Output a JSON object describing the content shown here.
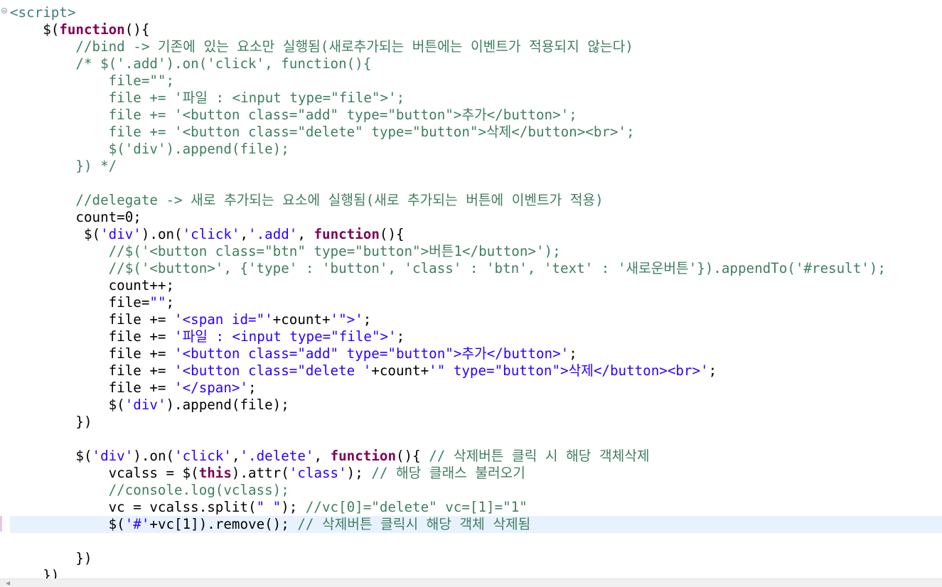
{
  "editor": {
    "lines": [
      [
        {
          "t": "<script>",
          "c": "tag"
        }
      ],
      [
        {
          "t": "    $(",
          "c": ""
        },
        {
          "t": "function",
          "c": "kw"
        },
        {
          "t": "(){",
          "c": ""
        }
      ],
      [
        {
          "t": "        //bind -> 기존에 있는 요소만 실행됨(새로추가되는 버튼에는 이벤트가 적용되지 않는다)",
          "c": "cm"
        }
      ],
      [
        {
          "t": "        /* $('.add').on('click', function(){",
          "c": "cm"
        }
      ],
      [
        {
          "t": "            file=\"\";",
          "c": "cm"
        }
      ],
      [
        {
          "t": "            file += '파일 : <input type=\"file\">';",
          "c": "cm"
        }
      ],
      [
        {
          "t": "            file += '<button class=\"add\" type=\"button\">추가</button>';",
          "c": "cm"
        }
      ],
      [
        {
          "t": "            file += '<button class=\"delete\" type=\"button\">삭제</button><br>';",
          "c": "cm"
        }
      ],
      [
        {
          "t": "            $('div').append(file);",
          "c": "cm"
        }
      ],
      [
        {
          "t": "        }) */",
          "c": "cm"
        }
      ],
      [
        {
          "t": "",
          "c": ""
        }
      ],
      [
        {
          "t": "        //delegate -> 새로 추가되는 요소에 실행됨(새로 추가되는 버튼에 이벤트가 적용)",
          "c": "cm"
        }
      ],
      [
        {
          "t": "        count=0;",
          "c": ""
        }
      ],
      [
        {
          "t": "         $(",
          "c": ""
        },
        {
          "t": "'div'",
          "c": "str"
        },
        {
          "t": ").on(",
          "c": ""
        },
        {
          "t": "'click'",
          "c": "str"
        },
        {
          "t": ",",
          "c": ""
        },
        {
          "t": "'.add'",
          "c": "str"
        },
        {
          "t": ", ",
          "c": ""
        },
        {
          "t": "function",
          "c": "kw"
        },
        {
          "t": "(){",
          "c": ""
        }
      ],
      [
        {
          "t": "            //$('<button class=\"btn\" type=\"button\">버튼1</button>');",
          "c": "cm"
        }
      ],
      [
        {
          "t": "            //$('<button>', {'type' : 'button', 'class' : 'btn', 'text' : '새로운버튼'}).appendTo('#result');",
          "c": "cm"
        }
      ],
      [
        {
          "t": "            count++;",
          "c": ""
        }
      ],
      [
        {
          "t": "            file=",
          "c": ""
        },
        {
          "t": "\"\"",
          "c": "str"
        },
        {
          "t": ";",
          "c": ""
        }
      ],
      [
        {
          "t": "            file += ",
          "c": ""
        },
        {
          "t": "'<span id=\"'",
          "c": "str"
        },
        {
          "t": "+count+",
          "c": ""
        },
        {
          "t": "'\">'",
          "c": "str"
        },
        {
          "t": ";",
          "c": ""
        }
      ],
      [
        {
          "t": "            file += ",
          "c": ""
        },
        {
          "t": "'파일 : <input type=\"file\">'",
          "c": "str"
        },
        {
          "t": ";",
          "c": ""
        }
      ],
      [
        {
          "t": "            file += ",
          "c": ""
        },
        {
          "t": "'<button class=\"add\" type=\"button\">추가</button>'",
          "c": "str"
        },
        {
          "t": ";",
          "c": ""
        }
      ],
      [
        {
          "t": "            file += ",
          "c": ""
        },
        {
          "t": "'<button class=\"delete '",
          "c": "str"
        },
        {
          "t": "+count+",
          "c": ""
        },
        {
          "t": "'\" type=\"button\">삭제</button><br>'",
          "c": "str"
        },
        {
          "t": ";",
          "c": ""
        }
      ],
      [
        {
          "t": "            file += ",
          "c": ""
        },
        {
          "t": "'</span>'",
          "c": "str"
        },
        {
          "t": ";",
          "c": ""
        }
      ],
      [
        {
          "t": "            $(",
          "c": ""
        },
        {
          "t": "'div'",
          "c": "str"
        },
        {
          "t": ").append(file);",
          "c": ""
        }
      ],
      [
        {
          "t": "        })",
          "c": ""
        }
      ],
      [
        {
          "t": "",
          "c": ""
        }
      ],
      [
        {
          "t": "        $(",
          "c": ""
        },
        {
          "t": "'div'",
          "c": "str"
        },
        {
          "t": ").on(",
          "c": ""
        },
        {
          "t": "'click'",
          "c": "str"
        },
        {
          "t": ",",
          "c": ""
        },
        {
          "t": "'.delete'",
          "c": "str"
        },
        {
          "t": ", ",
          "c": ""
        },
        {
          "t": "function",
          "c": "kw"
        },
        {
          "t": "(){ ",
          "c": ""
        },
        {
          "t": "// 삭제버튼 클릭 시 해당 객체삭제",
          "c": "cm"
        }
      ],
      [
        {
          "t": "            vcalss = $(",
          "c": ""
        },
        {
          "t": "this",
          "c": "kw"
        },
        {
          "t": ").attr(",
          "c": ""
        },
        {
          "t": "'class'",
          "c": "str"
        },
        {
          "t": "); ",
          "c": ""
        },
        {
          "t": "// 해당 클래스 불러오기",
          "c": "cm"
        }
      ],
      [
        {
          "t": "            //console.log(vclass);",
          "c": "cm"
        }
      ],
      [
        {
          "t": "            vc = vcalss.split(",
          "c": ""
        },
        {
          "t": "\" \"",
          "c": "str"
        },
        {
          "t": "); ",
          "c": ""
        },
        {
          "t": "//vc[0]=\"delete\" vc=[1]=\"1\"",
          "c": "cm"
        }
      ],
      [
        {
          "t": "            $(",
          "c": ""
        },
        {
          "t": "'#'",
          "c": "str"
        },
        {
          "t": "+vc[1]).remove(); ",
          "c": ""
        },
        {
          "t": "// 삭제버튼 클릭시 해당 객체 삭제됨",
          "c": "cm"
        }
      ],
      [
        {
          "t": "",
          "c": ""
        }
      ],
      [
        {
          "t": "        })",
          "c": ""
        }
      ],
      [
        {
          "t": "    })",
          "c": ""
        }
      ]
    ],
    "current_line": 30
  }
}
